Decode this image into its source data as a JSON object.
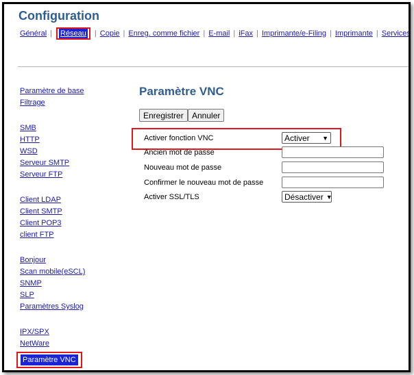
{
  "header": {
    "title": "Configuration"
  },
  "topnav": {
    "items": [
      {
        "label": "Général"
      },
      {
        "label": "Réseau",
        "active": true
      },
      {
        "label": "Copie"
      },
      {
        "label": "Enreg. comme fichier"
      },
      {
        "label": "E-mail"
      },
      {
        "label": "iFax"
      },
      {
        "label": "Imprimante/e-Filing"
      },
      {
        "label": "Imprimante"
      },
      {
        "label": "Services d'imp"
      }
    ]
  },
  "sidebar": {
    "groups": [
      [
        "Paramètre de base",
        "Filtrage"
      ],
      [
        "SMB",
        "HTTP",
        "WSD",
        "Serveur SMTP",
        "Serveur FTP"
      ],
      [
        "Client LDAP",
        "Client SMTP",
        "Client POP3",
        "client FTP"
      ],
      [
        "Bonjour",
        "Scan mobile(eSCL)",
        "SNMP",
        "SLP",
        "Paramètres Syslog"
      ],
      [
        "IPX/SPX",
        "NetWare",
        "Paramètre VNC"
      ]
    ],
    "active": "Paramètre VNC"
  },
  "main": {
    "title": "Paramètre VNC",
    "save_label": "Enregistrer",
    "cancel_label": "Annuler",
    "fields": {
      "vnc_enable": {
        "label": "Activer fonction VNC",
        "value": "Activer"
      },
      "old_password": {
        "label": "Ancien mot de passe",
        "value": ""
      },
      "new_password": {
        "label": "Nouveau mot de passe",
        "value": ""
      },
      "confirm_password": {
        "label": "Confirmer le nouveau mot de passe",
        "value": ""
      },
      "ssl_tls": {
        "label": "Activer SSL/TLS",
        "value": "Désactiver"
      }
    }
  },
  "colors": {
    "link": "#1a1aa6",
    "title": "#2e5d94",
    "active_bg": "#1a23d6",
    "highlight": "#e0161b"
  }
}
